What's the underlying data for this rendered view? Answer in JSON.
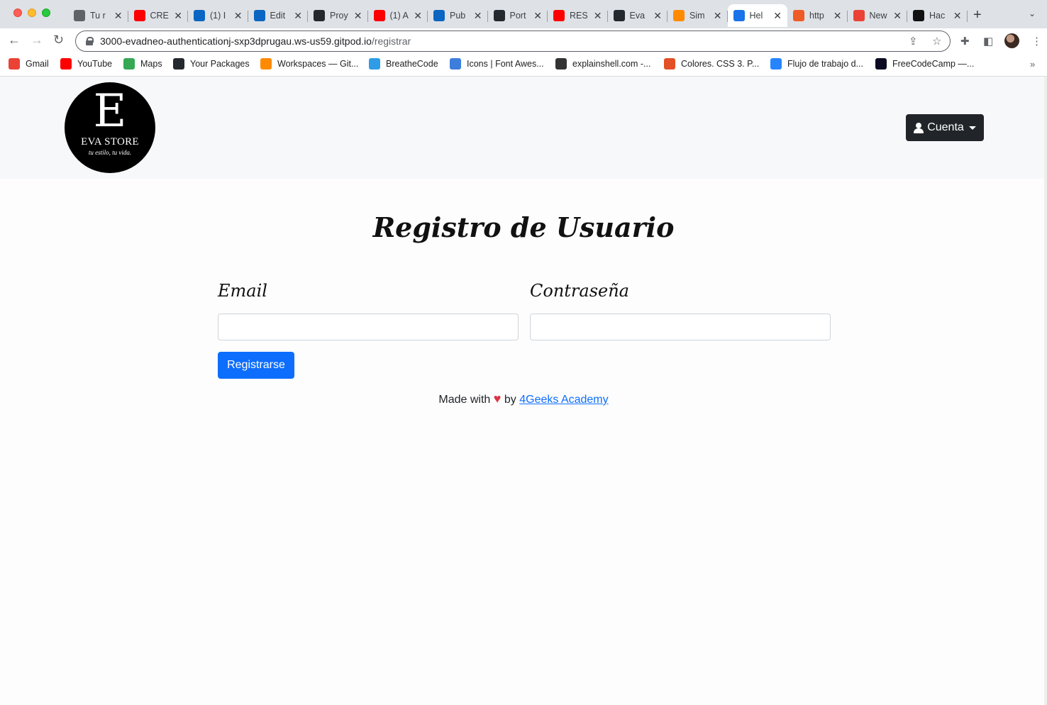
{
  "browser": {
    "tabs": [
      {
        "title": "Tu r",
        "icon": "globe-icon",
        "color": "#5f6368"
      },
      {
        "title": "CRE",
        "icon": "youtube-icon",
        "color": "#ff0000"
      },
      {
        "title": "(1) I",
        "icon": "linkedin-icon",
        "color": "#0a66c2"
      },
      {
        "title": "Edit",
        "icon": "linkedin-icon",
        "color": "#0a66c2"
      },
      {
        "title": "Proy",
        "icon": "github-icon",
        "color": "#24292f"
      },
      {
        "title": "(1) A",
        "icon": "youtube-icon",
        "color": "#ff0000"
      },
      {
        "title": "Pub",
        "icon": "linkedin-icon",
        "color": "#0a66c2"
      },
      {
        "title": "Port",
        "icon": "github-icon",
        "color": "#24292f"
      },
      {
        "title": "RES",
        "icon": "youtube-icon",
        "color": "#ff0000"
      },
      {
        "title": "Eva",
        "icon": "github-icon",
        "color": "#24292f"
      },
      {
        "title": "Sim",
        "icon": "gitpod-icon",
        "color": "#ff8a00"
      },
      {
        "title": "Hel",
        "icon": "react-icon",
        "color": "#1a73e8"
      },
      {
        "title": "http",
        "icon": "postman-icon",
        "color": "#ef5b25"
      },
      {
        "title": "New",
        "icon": "gmail-icon",
        "color": "#ea4335"
      },
      {
        "title": "Hac",
        "icon": "hackerrank-icon",
        "color": "#111111"
      }
    ],
    "active_tab_index": 11,
    "new_tab_label": "+",
    "url_host": "3000-evadneo-authenticationj-sxp3dprugau.ws-us59.gitpod.io",
    "url_path": "/registrar",
    "bookmarks": [
      {
        "label": "Gmail",
        "icon": "gmail-icon",
        "color": "#ea4335"
      },
      {
        "label": "YouTube",
        "icon": "youtube-icon",
        "color": "#ff0000"
      },
      {
        "label": "Maps",
        "icon": "maps-icon",
        "color": "#34a853"
      },
      {
        "label": "Your Packages",
        "icon": "github-icon",
        "color": "#24292f"
      },
      {
        "label": "Workspaces — Git...",
        "icon": "gitpod-icon",
        "color": "#ff8a00"
      },
      {
        "label": "BreatheCode",
        "icon": "breathecode-icon",
        "color": "#2e9ce6"
      },
      {
        "label": "Icons | Font Awes...",
        "icon": "flag-icon",
        "color": "#3d7ddc"
      },
      {
        "label": "explainshell.com -...",
        "icon": "shell-icon",
        "color": "#333333"
      },
      {
        "label": "Colores. CSS 3. P...",
        "icon": "html5-icon",
        "color": "#e34f26"
      },
      {
        "label": "Flujo de trabajo d...",
        "icon": "atlassian-icon",
        "color": "#2684ff"
      },
      {
        "label": "FreeCodeCamp —...",
        "icon": "freecodecamp-icon",
        "color": "#0a0a23"
      }
    ]
  },
  "navbar": {
    "logo_letter": "E",
    "logo_name": "EVA STORE",
    "logo_tagline": "tu estilo, tu vida.",
    "account_label": "Cuenta"
  },
  "form": {
    "title": "Registro de Usuario",
    "email_label": "Email",
    "email_value": "",
    "password_label": "Contraseña",
    "password_value": "",
    "submit_label": "Registrarse"
  },
  "footer": {
    "prefix": "Made with",
    "heart": "♥",
    "by": "by",
    "link_text": "4Geeks Academy"
  }
}
